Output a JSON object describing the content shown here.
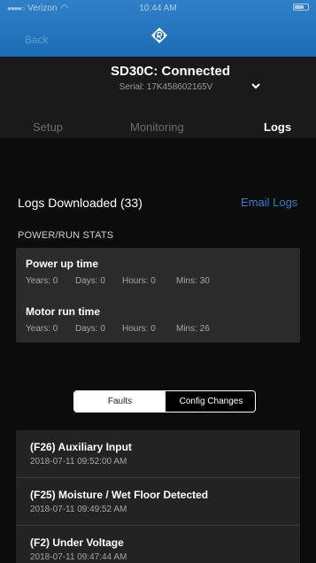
{
  "status_bar": {
    "carrier": "Verizon",
    "time": "10:44 AM"
  },
  "header": {
    "back_label": "Back"
  },
  "device": {
    "title": "SD30C: Connected",
    "serial": "Serial: 17K458602165V"
  },
  "tabs": [
    {
      "label": "Setup",
      "active": false
    },
    {
      "label": "Monitoring",
      "active": false
    },
    {
      "label": "Logs",
      "active": true
    }
  ],
  "logs": {
    "title": "Logs Downloaded (33)",
    "email_label": "Email Logs"
  },
  "power_run": {
    "section_label": "POWER/RUN STATS",
    "power_up": {
      "title": "Power up time",
      "years": "Years: 0",
      "days": "Days: 0",
      "hours": "Hours: 0",
      "mins": "Mins: 30"
    },
    "motor_run": {
      "title": "Motor run time",
      "years": "Years: 0",
      "days": "Days: 0",
      "hours": "Hours: 0",
      "mins": "Mins: 26"
    }
  },
  "segment": {
    "faults": "Faults",
    "config": "Config Changes",
    "selected": "Faults"
  },
  "faults": [
    {
      "title": "(F26) Auxiliary Input",
      "time": "2018-07-11 09:52:00 AM"
    },
    {
      "title": "(F25) Moisture / Wet Floor Detected",
      "time": "2018-07-11 09:49:52 AM"
    },
    {
      "title": "(F2) Under Voltage",
      "time": "2018-07-11 09:47:44 AM"
    }
  ],
  "colors": {
    "header_blue": "#1b6cb3",
    "link_blue": "#2a7fc9",
    "card_bg": "#2b2b2b"
  }
}
